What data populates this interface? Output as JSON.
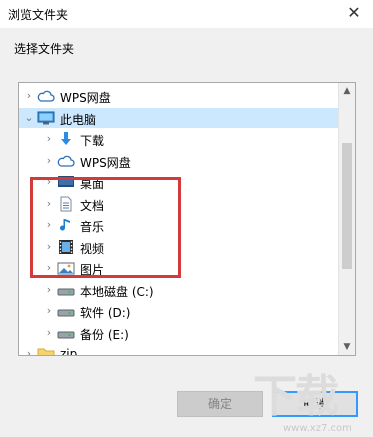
{
  "window": {
    "title": "浏览文件夹",
    "close_glyph": "✕"
  },
  "prompt": "选择文件夹",
  "tree": [
    {
      "label": "WPS网盘",
      "icon": "cloud-icon",
      "chevron": "›",
      "level": 0
    },
    {
      "label": "此电脑",
      "icon": "computer-icon",
      "chevron": "⌄",
      "level": 0,
      "selected": true
    },
    {
      "label": "下载",
      "icon": "download-arrow-icon",
      "chevron": "›",
      "level": 1
    },
    {
      "label": "WPS网盘",
      "icon": "cloud-icon",
      "chevron": "›",
      "level": 1
    },
    {
      "label": "桌面",
      "icon": "desktop-icon",
      "chevron": "›",
      "level": 1
    },
    {
      "label": "文档",
      "icon": "document-icon",
      "chevron": "›",
      "level": 1
    },
    {
      "label": "音乐",
      "icon": "music-note-icon",
      "chevron": "›",
      "level": 1
    },
    {
      "label": "视频",
      "icon": "film-icon",
      "chevron": "›",
      "level": 1
    },
    {
      "label": "图片",
      "icon": "picture-icon",
      "chevron": "›",
      "level": 1
    },
    {
      "label": "本地磁盘 (C:)",
      "icon": "drive-icon",
      "chevron": "›",
      "level": 1
    },
    {
      "label": "软件 (D:)",
      "icon": "drive-icon",
      "chevron": "›",
      "level": 1
    },
    {
      "label": "备份 (E:)",
      "icon": "drive-icon",
      "chevron": "›",
      "level": 1
    },
    {
      "label": "zip",
      "icon": "folder-icon",
      "chevron": "›",
      "level": 0
    }
  ],
  "scrollbar": {
    "up_glyph": "▲",
    "down_glyph": "▼"
  },
  "buttons": {
    "ok": "确定",
    "cancel": "取消"
  },
  "watermark": {
    "text": "下载",
    "url": "www.xz7.com"
  },
  "colors": {
    "highlight": "#d33a3a",
    "selection": "#cce8ff",
    "accent": "#3399ff"
  }
}
